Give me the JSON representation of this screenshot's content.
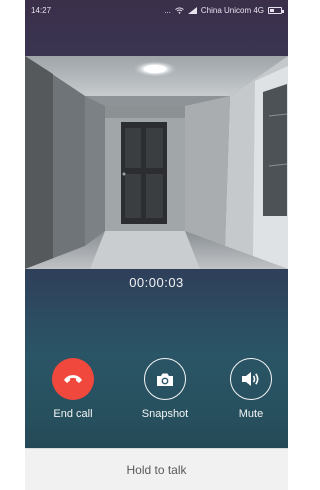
{
  "status_bar": {
    "time": "14:27",
    "carrier": "China Unicom 4G",
    "more_dots": "..."
  },
  "call": {
    "duration": "00:00:03"
  },
  "controls": {
    "end_call_label": "End call",
    "snapshot_label": "Snapshot",
    "mute_label": "Mute"
  },
  "talk": {
    "hold_label": "Hold to talk"
  },
  "colors": {
    "end_call": "#f1483e",
    "background_top": "#3b2f4a",
    "background_bottom": "#223e4d",
    "talk_bar": "#f1f1f1"
  }
}
